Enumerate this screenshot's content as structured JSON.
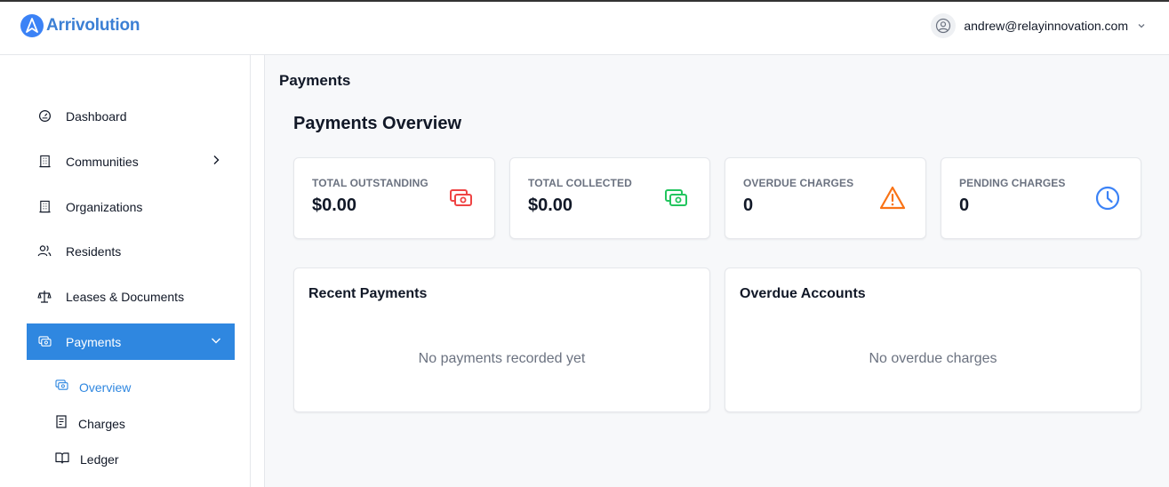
{
  "app": {
    "name": "Arrivolution"
  },
  "user": {
    "email": "andrew@relayinnovation.com"
  },
  "sidebar": {
    "items": [
      {
        "label": "Dashboard",
        "icon": "gauge-icon"
      },
      {
        "label": "Communities",
        "icon": "building-icon"
      },
      {
        "label": "Organizations",
        "icon": "building-icon"
      },
      {
        "label": "Residents",
        "icon": "users-icon"
      },
      {
        "label": "Leases & Documents",
        "icon": "scale-icon"
      },
      {
        "label": "Payments",
        "icon": "money-icon"
      }
    ],
    "sub_items": [
      {
        "label": "Overview",
        "icon": "money-icon"
      },
      {
        "label": "Charges",
        "icon": "receipt-icon"
      },
      {
        "label": "Ledger",
        "icon": "book-icon"
      }
    ]
  },
  "page": {
    "breadcrumb": "Payments",
    "title": "Payments Overview"
  },
  "stats": [
    {
      "label": "TOTAL OUTSTANDING",
      "value": "$0.00",
      "icon": "money-icon",
      "color": "#ef4444"
    },
    {
      "label": "TOTAL COLLECTED",
      "value": "$0.00",
      "icon": "money-icon",
      "color": "#22c55e"
    },
    {
      "label": "OVERDUE CHARGES",
      "value": "0",
      "icon": "warning-icon",
      "color": "#f97316"
    },
    {
      "label": "PENDING CHARGES",
      "value": "0",
      "icon": "clock-icon",
      "color": "#3b82f6"
    }
  ],
  "panels": {
    "recent_payments": {
      "title": "Recent Payments",
      "empty": "No payments recorded yet"
    },
    "overdue_accounts": {
      "title": "Overdue Accounts",
      "empty": "No overdue charges"
    }
  },
  "colors": {
    "accent": "#2f87e0",
    "brand": "#3b7fd4"
  }
}
